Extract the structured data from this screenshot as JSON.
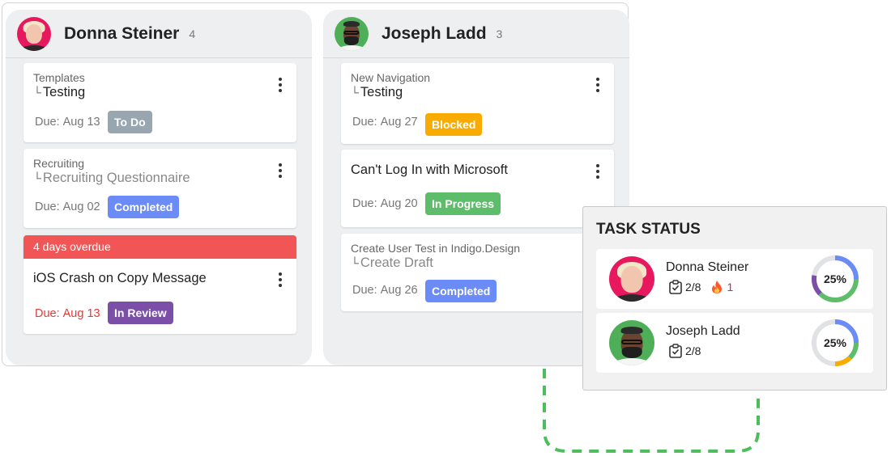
{
  "columns": [
    {
      "name": "Donna Steiner",
      "count": "4",
      "cards": [
        {
          "parent": "Templates",
          "child": "Testing",
          "due_label": "Due:",
          "due_date": "Aug 13",
          "status": "To Do"
        },
        {
          "parent": "Recruiting",
          "child": "Recruiting Questionnaire",
          "due_label": "Due:",
          "due_date": "Aug 02",
          "status": "Completed"
        },
        {
          "overdue": "4 days overdue",
          "title": "iOS Crash on Copy Message",
          "due_label": "Due:",
          "due_date": "Aug 13",
          "status": "In Review"
        }
      ]
    },
    {
      "name": "Joseph Ladd",
      "count": "3",
      "cards": [
        {
          "parent": "New Navigation",
          "child": "Testing",
          "due_label": "Due:",
          "due_date": "Aug 27",
          "status": "Blocked"
        },
        {
          "title": "Can't Log In with Microsoft",
          "due_label": "Due:",
          "due_date": "Aug 20",
          "status": "In Progress"
        },
        {
          "parent": "Create User Test in Indigo.Design",
          "child": "Create Draft",
          "due_label": "Due:",
          "due_date": "Aug 26",
          "status": "Completed"
        }
      ]
    }
  ],
  "task_status": {
    "title": "TASK STATUS",
    "people": [
      {
        "name": "Donna Steiner",
        "tasks": "2/8",
        "hot": "1",
        "percent": "25%"
      },
      {
        "name": "Joseph Ladd",
        "tasks": "2/8",
        "percent": "25%"
      }
    ]
  },
  "colors": {
    "to_do": "#98a6b0",
    "completed": "#6b8cf7",
    "in_review": "#7b4fa8",
    "blocked": "#f9ab00",
    "in_progress": "#5ebd6a",
    "overdue": "#f25555",
    "connector": "#4ebd5c"
  },
  "icons": [
    "more-vertical-icon",
    "checklist-icon",
    "fire-icon",
    "tree-branch-icon"
  ]
}
